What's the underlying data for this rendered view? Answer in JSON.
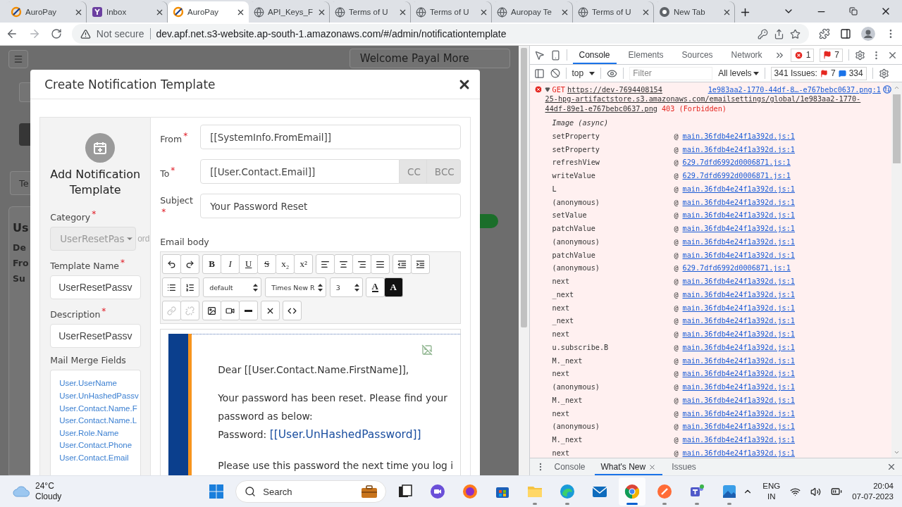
{
  "browser": {
    "tabs": [
      {
        "title": "AuroPay",
        "kind": "auropay",
        "selected": false
      },
      {
        "title": "Inbox",
        "kind": "inbox",
        "selected": false
      },
      {
        "title": "AuroPay",
        "kind": "auropay",
        "selected": true
      },
      {
        "title": "API_Keys_F",
        "kind": "globe",
        "selected": false
      },
      {
        "title": "Terms of U",
        "kind": "globe",
        "selected": false
      },
      {
        "title": "Terms of U",
        "kind": "globe",
        "selected": false
      },
      {
        "title": "Auropay Te",
        "kind": "globe",
        "selected": false
      },
      {
        "title": "Terms of U",
        "kind": "globe",
        "selected": false
      },
      {
        "title": "New Tab",
        "kind": "newtab",
        "selected": false
      }
    ],
    "security": "Not secure",
    "url": "dev.apf.net.s3-website.ap-south-1.amazonaws.com/#/admin/notificationtemplate"
  },
  "page": {
    "welcome": "Welcome Payal More",
    "fragments": [
      {
        "text": "Te",
        "kind": "tab"
      },
      {
        "text": "Us",
        "kind": "title"
      },
      {
        "text": "De",
        "kind": "line"
      },
      {
        "text": "Fro",
        "kind": "line"
      },
      {
        "text": "Su",
        "kind": "line"
      }
    ]
  },
  "modal": {
    "title": "Create Notification Template",
    "sidebar": {
      "heading": "Add Notification Template",
      "category": {
        "label": "Category",
        "asterisk": "*",
        "value": "UserResetPas",
        "overflow": "ord",
        "disabled": true
      },
      "template_name": {
        "label": "Template Name",
        "asterisk": "*",
        "value": "UserResetPassv"
      },
      "description": {
        "label": "Description",
        "asterisk": "*",
        "value": "UserResetPassv"
      },
      "merge_fields": {
        "label": "Mail Merge Fields",
        "items": [
          "User.UserName",
          "User.UnHashedPassv",
          "User.Contact.Name.F",
          "User.Contact.Name.L",
          "User.Role.Name",
          "User.Contact.Phone",
          "User.Contact.Email"
        ]
      }
    },
    "form": {
      "from": {
        "label": "From",
        "asterisk": "*",
        "value": "[[SystemInfo.FromEmail]]"
      },
      "to": {
        "label": "To",
        "asterisk": "*",
        "value": "[[User.Contact.Email]]",
        "addons": [
          "CC",
          "BCC"
        ]
      },
      "subject": {
        "label": "Subject",
        "asterisk": "*",
        "value": "Your Password Reset"
      },
      "body_label": "Email body",
      "toolbar": [
        [
          [
            {
              "kind": "icon",
              "disabled": false
            },
            {
              "kind": "icon",
              "disabled": false
            }
          ],
          [
            {
              "kind": "text",
              "label": "B"
            },
            {
              "kind": "text",
              "label": "I"
            },
            {
              "kind": "text",
              "label": "U"
            },
            {
              "kind": "text",
              "label": "S"
            },
            {
              "kind": "text",
              "label": "x₂"
            },
            {
              "kind": "text",
              "label": "x²"
            }
          ],
          [
            {
              "kind": "icon",
              "disabled": false
            },
            {
              "kind": "icon",
              "disabled": false
            },
            {
              "kind": "icon",
              "disabled": false
            },
            {
              "kind": "icon",
              "disabled": false
            }
          ],
          [
            {
              "kind": "icon",
              "disabled": false
            },
            {
              "kind": "icon",
              "disabled": false
            }
          ]
        ],
        [
          [
            {
              "kind": "icon",
              "disabled": false
            },
            {
              "kind": "icon",
              "disabled": false
            }
          ],
          [
            {
              "kind": "select",
              "value": "default"
            }
          ],
          [
            {
              "kind": "select",
              "value": "Times New R"
            }
          ],
          [
            {
              "kind": "select",
              "value": "3"
            }
          ],
          [
            {
              "kind": "forecolor",
              "label": "A"
            },
            {
              "kind": "backcolor",
              "label": "A"
            }
          ]
        ],
        [
          [
            {
              "kind": "icon",
              "disabled": true
            },
            {
              "kind": "icon",
              "disabled": true
            }
          ],
          [
            {
              "kind": "icon",
              "disabled": false
            },
            {
              "kind": "icon",
              "disabled": false
            },
            {
              "kind": "icon",
              "disabled": false
            }
          ],
          [
            {
              "kind": "icon",
              "disabled": false
            }
          ],
          [
            {
              "kind": "icon",
              "disabled": false
            }
          ]
        ]
      ],
      "content": {
        "greeting": "Dear [[User.Contact.Name.FirstName]],",
        "lines": [
          "Your password has been reset. Please find your",
          "password as below:"
        ],
        "password_label": "Password:",
        "password_value": "[[User.UnHashedPassword]]",
        "closing": "Please use this password the next time you log i"
      }
    }
  },
  "devtools": {
    "tabs": [
      {
        "label": "Console",
        "selected": true
      },
      {
        "label": "Elements",
        "selected": false
      },
      {
        "label": "Sources",
        "selected": false
      },
      {
        "label": "Network",
        "selected": false
      }
    ],
    "errors": "1",
    "warnings": "7",
    "context": "top",
    "filter_placeholder": "Filter",
    "levels": "All levels",
    "issues": {
      "label": "341 Issues:",
      "warnings": "7",
      "infos": "334"
    },
    "error": {
      "method": "GET",
      "url_start": "https://dev-7694408154",
      "source": "1e983aa2-1770-44df-8…-e767bebc0637.png:1",
      "url_rest": [
        "25-hpg-artifactstore.s3.amazonaws.com/emailsettings/global/1e983aa2-1770-",
        "44df-89e1-e767bebc0637.png"
      ],
      "status": "403 (Forbidden)",
      "async": "Image (async)"
    },
    "frames": [
      {
        "fn": "setProperty",
        "at": "@",
        "src": "main.36fdb4e24f1a392d.js:1"
      },
      {
        "fn": "setProperty",
        "at": "@",
        "src": "main.36fdb4e24f1a392d.js:1"
      },
      {
        "fn": "refreshView",
        "at": "@",
        "src": "629.7dfd6992d0006871.js:1"
      },
      {
        "fn": "writeValue",
        "at": "@",
        "src": "629.7dfd6992d0006871.js:1"
      },
      {
        "fn": "L",
        "at": "@",
        "src": "main.36fdb4e24f1a392d.js:1"
      },
      {
        "fn": "(anonymous)",
        "at": "@",
        "src": "main.36fdb4e24f1a392d.js:1"
      },
      {
        "fn": "setValue",
        "at": "@",
        "src": "main.36fdb4e24f1a392d.js:1"
      },
      {
        "fn": "patchValue",
        "at": "@",
        "src": "main.36fdb4e24f1a392d.js:1"
      },
      {
        "fn": "(anonymous)",
        "at": "@",
        "src": "main.36fdb4e24f1a392d.js:1"
      },
      {
        "fn": "patchValue",
        "at": "@",
        "src": "main.36fdb4e24f1a392d.js:1"
      },
      {
        "fn": "(anonymous)",
        "at": "@",
        "src": "629.7dfd6992d0006871.js:1"
      },
      {
        "fn": "next",
        "at": "@",
        "src": "main.36fdb4e24f1a392d.js:1"
      },
      {
        "fn": "_next",
        "at": "@",
        "src": "main.36fdb4e24f1a392d.js:1"
      },
      {
        "fn": "next",
        "at": "@",
        "src": "main.36fdb4e24f1a392d.js:1"
      },
      {
        "fn": "_next",
        "at": "@",
        "src": "main.36fdb4e24f1a392d.js:1"
      },
      {
        "fn": "next",
        "at": "@",
        "src": "main.36fdb4e24f1a392d.js:1"
      },
      {
        "fn": "u.subscribe.B",
        "at": "@",
        "src": "main.36fdb4e24f1a392d.js:1"
      },
      {
        "fn": "M._next",
        "at": "@",
        "src": "main.36fdb4e24f1a392d.js:1"
      },
      {
        "fn": "next",
        "at": "@",
        "src": "main.36fdb4e24f1a392d.js:1"
      },
      {
        "fn": "(anonymous)",
        "at": "@",
        "src": "main.36fdb4e24f1a392d.js:1"
      },
      {
        "fn": "M._next",
        "at": "@",
        "src": "main.36fdb4e24f1a392d.js:1"
      },
      {
        "fn": "next",
        "at": "@",
        "src": "main.36fdb4e24f1a392d.js:1"
      },
      {
        "fn": "(anonymous)",
        "at": "@",
        "src": "main.36fdb4e24f1a392d.js:1"
      },
      {
        "fn": "M._next",
        "at": "@",
        "src": "main.36fdb4e24f1a392d.js:1"
      },
      {
        "fn": "next",
        "at": "@",
        "src": "main.36fdb4e24f1a392d.js:1"
      }
    ],
    "drawer_tabs": [
      {
        "label": "Console",
        "selected": false,
        "closable": false
      },
      {
        "label": "What's New",
        "selected": true,
        "closable": true
      },
      {
        "label": "Issues",
        "selected": false,
        "closable": false
      }
    ]
  },
  "taskbar": {
    "weather": {
      "temp": "24°C",
      "condition": "Cloudy"
    },
    "search": "Search",
    "apps": [
      {
        "kind": "start",
        "running": false
      },
      {
        "kind": "taskview",
        "running": false
      },
      {
        "kind": "meet",
        "running": false
      },
      {
        "kind": "firefox",
        "running": false
      },
      {
        "kind": "store",
        "running": false
      },
      {
        "kind": "files",
        "running": true
      },
      {
        "kind": "edge",
        "running": true
      },
      {
        "kind": "mail",
        "running": false
      },
      {
        "kind": "chrome",
        "running": true
      },
      {
        "kind": "postman",
        "running": true
      },
      {
        "kind": "teams",
        "running": true
      },
      {
        "kind": "photos",
        "running": true
      }
    ],
    "language": "ENG",
    "region": "IN",
    "time": "20:04",
    "date": "07-07-2023"
  }
}
